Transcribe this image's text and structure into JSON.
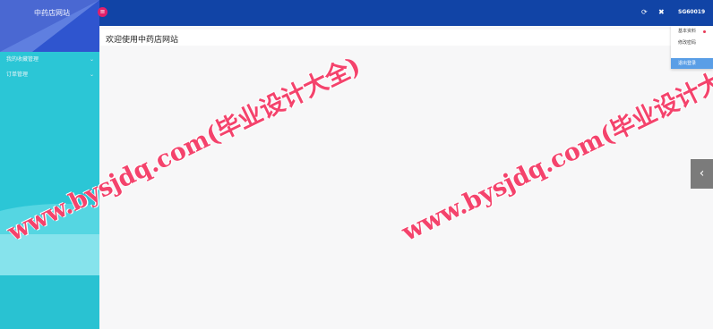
{
  "sidebar": {
    "logo_text": "中药店网站",
    "items": [
      {
        "label": "我的收藏管理"
      },
      {
        "label": "订单管理"
      }
    ]
  },
  "header": {
    "menu_toggle_icon": "menu-toggle-icon",
    "refresh_icon": "refresh-icon",
    "fullscreen_icon": "fullscreen-icon",
    "user_name": "SG60019"
  },
  "user_dropdown": {
    "items": [
      {
        "label": "基本资料"
      },
      {
        "label": "修改密码"
      }
    ],
    "logout_label": "退出登录"
  },
  "main": {
    "welcome_title": "欢迎使用中药店网站"
  },
  "watermark": {
    "text": "www.bysjdq.com(毕业设计大全)"
  },
  "colors": {
    "header": "#1144a6",
    "sidebar": "#2bc6d6",
    "watermark": "#f4436c",
    "toggle": "#e1206a"
  }
}
